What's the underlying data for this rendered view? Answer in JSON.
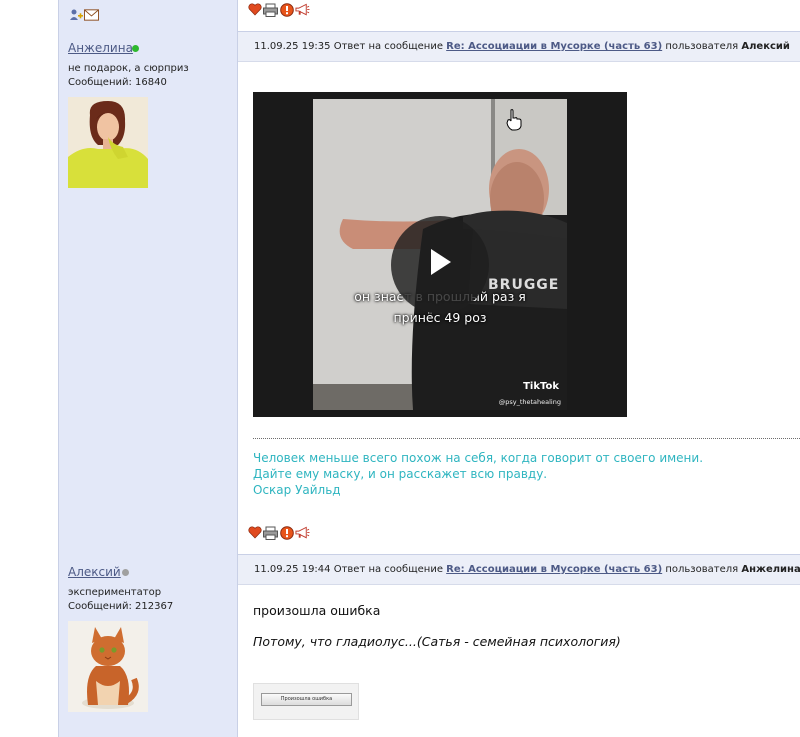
{
  "posts": [
    {
      "author": "Анжелина",
      "online": true,
      "status": "не подарок, а сюрприз",
      "count_text": "Сообщений: 16840",
      "date": "11.09.25 19:35",
      "reply_prefix": "Ответ на сообщение",
      "reply_link": "Re: Ассоциации в Мусорке (часть 63)",
      "reply_user_prefix": "пользователя",
      "reply_user": "Алексий",
      "video": {
        "caption_line1": "он знает в прошлый раз я",
        "caption_line2": "принёс 49 роз",
        "logo": "TikTok",
        "handle": "@psy_thetahealing",
        "shirt_text": "BRUGGE"
      },
      "signature": [
        "Человек меньше всего похож на себя, когда говорит от своего имени.",
        "Дайте ему маску, и он расскажет всю правду.",
        "Оскар Уайльд"
      ]
    },
    {
      "author": "Алексий",
      "online": false,
      "status": "экспериментатор",
      "count_text": "Сообщений: 212367",
      "date": "11.09.25 19:44",
      "reply_prefix": "Ответ на сообщение",
      "reply_link": "Re: Ассоциации в Мусорке (часть 63)",
      "reply_user_prefix": "пользователя",
      "reply_user": "Анжелина",
      "message": "произошла ошибка",
      "italic_message": "Потому, что гладиолус...(Сатья - семейная психология)",
      "thumb_text": "Произошла ошибка"
    }
  ],
  "icons": {
    "top_left": [
      "add-friend-icon",
      "mail-icon"
    ],
    "actions": [
      "heart-icon",
      "print-icon",
      "report-icon",
      "megaphone-icon"
    ]
  },
  "colors": {
    "sidebar_bg": "#e3e8f8",
    "header_bg": "#eceff8",
    "link": "#4d5a86",
    "signature": "#2fb5c0",
    "online_dot": "#2eb82e",
    "offline_dot": "#a0a0a0"
  }
}
